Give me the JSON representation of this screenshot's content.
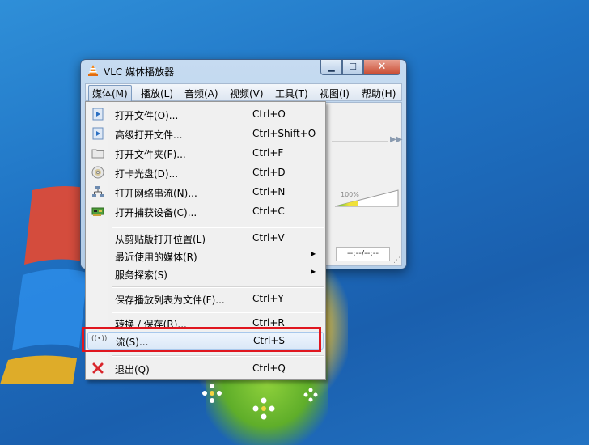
{
  "window": {
    "title": "VLC 媒体播放器",
    "controls": {
      "minimize": "▁",
      "maximize": "☐",
      "close": "✕"
    },
    "time_display": "--:--/--:--",
    "volume_label": "100%"
  },
  "menubar": [
    "媒体(M)",
    "播放(L)",
    "音频(A)",
    "视频(V)",
    "工具(T)",
    "视图(I)",
    "帮助(H)"
  ],
  "media_menu": [
    {
      "label": "打开文件(O)...",
      "shortcut": "Ctrl+O",
      "icon": "play-file-icon"
    },
    {
      "label": "高级打开文件...",
      "shortcut": "Ctrl+Shift+O",
      "icon": "play-file-icon"
    },
    {
      "label": "打开文件夹(F)...",
      "shortcut": "Ctrl+F",
      "icon": "folder-icon"
    },
    {
      "label": "打卡光盘(D)...",
      "shortcut": "Ctrl+D",
      "icon": "disc-icon"
    },
    {
      "label": "打开网络串流(N)...",
      "shortcut": "Ctrl+N",
      "icon": "network-icon"
    },
    {
      "label": "打开捕获设备(C)...",
      "shortcut": "Ctrl+C",
      "icon": "capture-card-icon"
    },
    {
      "label": "从剪贴版打开位置(L)",
      "shortcut": "Ctrl+V",
      "icon": ""
    },
    {
      "label": "最近使用的媒体(R)",
      "shortcut": "",
      "icon": ""
    },
    {
      "label": "服务探索(S)",
      "shortcut": "",
      "icon": ""
    },
    {
      "label": "保存播放列表为文件(F)...",
      "shortcut": "Ctrl+Y",
      "icon": ""
    },
    {
      "label": "转换 / 保存(R)...",
      "shortcut": "Ctrl+R",
      "icon": ""
    },
    {
      "label": "流(S)...",
      "shortcut": "Ctrl+S",
      "icon": "stream-icon"
    },
    {
      "label": "退出(Q)",
      "shortcut": "Ctrl+Q",
      "icon": "exit-icon"
    }
  ],
  "colors": {
    "highlight_box": "#e0161f",
    "exit_icon": "#d9262c"
  }
}
